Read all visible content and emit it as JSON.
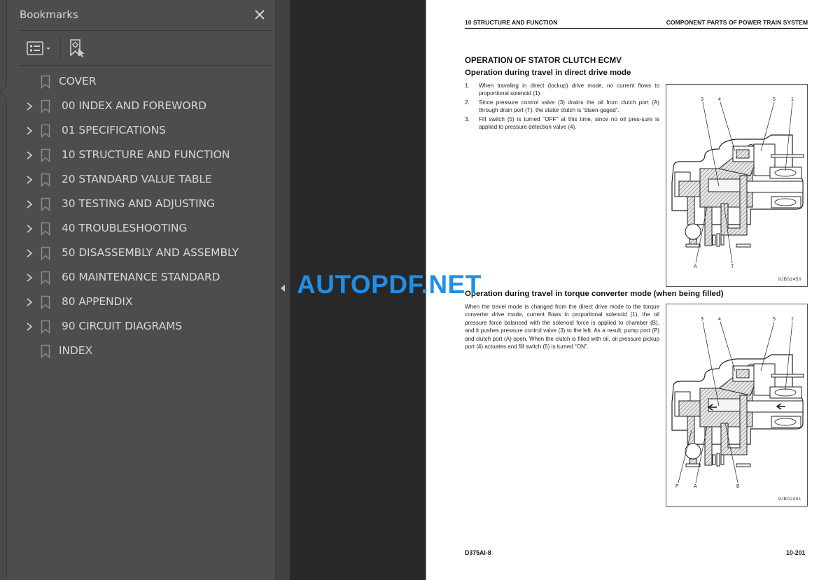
{
  "sidebar": {
    "title": "Bookmarks",
    "close_icon": "close-icon",
    "toolbar": {
      "options_icon": "bookmark-options-icon",
      "find_icon": "find-current-bookmark-icon"
    },
    "items": [
      {
        "label": "COVER",
        "expandable": false
      },
      {
        "label": "00 INDEX AND FOREWORD",
        "expandable": true
      },
      {
        "label": "01 SPECIFICATIONS",
        "expandable": true
      },
      {
        "label": "10 STRUCTURE AND FUNCTION",
        "expandable": true
      },
      {
        "label": "20 STANDARD VALUE TABLE",
        "expandable": true
      },
      {
        "label": "30 TESTING AND ADJUSTING",
        "expandable": true
      },
      {
        "label": "40 TROUBLESHOOTING",
        "expandable": true
      },
      {
        "label": "50 DISASSEMBLY AND ASSEMBLY",
        "expandable": true
      },
      {
        "label": "60 MAINTENANCE STANDARD",
        "expandable": true
      },
      {
        "label": "80 APPENDIX",
        "expandable": true
      },
      {
        "label": "90 CIRCUIT DIAGRAMS",
        "expandable": true
      },
      {
        "label": "INDEX",
        "expandable": false
      }
    ]
  },
  "watermark": "AUTOPDF.NET",
  "page": {
    "header_left": "10 STRUCTURE AND FUNCTION",
    "header_right": "COMPONENT PARTS OF POWER TRAIN SYSTEM",
    "title": "OPERATION OF STATOR CLUTCH ECMV",
    "section1": {
      "heading": "Operation during travel in direct drive mode",
      "steps": [
        {
          "num": "1.",
          "text": "When traveling in direct (lockup) drive mode, no current flows to proportional solenoid (1)."
        },
        {
          "num": "2.",
          "text": "Since pressure control valve (3) drains the oil from clutch port (A) through drain port (T), the stator clutch is “disen-gaged”."
        },
        {
          "num": "3.",
          "text": "Fill switch (5) is turned “OFF” at this time, since no oil pres-sure is applied to pressure detection valve (4)."
        }
      ],
      "figure": {
        "code": "9JB02450",
        "labels": {
          "l3": "3",
          "l4": "4",
          "l5": "5",
          "l1": "1",
          "lA": "A",
          "lT": "T"
        }
      }
    },
    "section2": {
      "heading": "Operation during travel in torque converter mode (when being filled)",
      "paragraph": "When the travel mode is changed from the direct drive mode to the torque converter drive mode, current flows in proportional solenoid (1), the oil pressure force balanced with the solenoid force is applied to chamber (B), and it pushes pressure control valve (3) to the left. As a result, pump port (P) and clutch port (A) open. When the clutch is filled with oil, oil pressure pickup port (4) actuates and fill switch (5) is turned “ON”.",
      "figure": {
        "code": "9JB02451",
        "labels": {
          "l3": "3",
          "l4": "4",
          "l5": "5",
          "l1": "1",
          "lP": "P",
          "lA": "A",
          "lB": "B"
        }
      }
    },
    "footer_left": "D375AI-8",
    "footer_right": "10-201"
  }
}
